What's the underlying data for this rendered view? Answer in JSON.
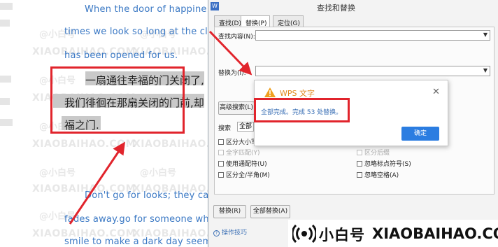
{
  "document": {
    "lines_en": [
      "When the door of happine",
      "times we look so long at the close",
      "has been opened for us.",
      "Don't go for looks; they can",
      "fades away.go for someone who",
      "smile to make a dark day seem b"
    ],
    "lines_cn": [
      "一扇通往幸福的门关闭了,",
      "我们徘徊在那扇关闭的门前,却",
      "福之门."
    ],
    "watermarks": [
      "@小白号",
      "XIAOBAIHAO.COM"
    ]
  },
  "dialog": {
    "title": "查找和替换",
    "logo": "W",
    "tabs": [
      "查找(D)",
      "替换(P)",
      "定位(G)"
    ],
    "find_label": "查找内容(N):",
    "replace_label": "替换为(I):",
    "advanced_button": "高级搜索(L)",
    "search_label": "搜索",
    "search_direction": "全部",
    "options_left": [
      "区分大小写",
      "全字匹配(Y)",
      "使用通配符(U)",
      "区分全/半角(M)"
    ],
    "options_right": [
      "区分后缀",
      "忽略标点符号(S)",
      "忽略空格(A)"
    ],
    "replace_button": "替换(R)",
    "replace_all_button": "全部替换(A)",
    "tips_link": "操作技巧"
  },
  "message": {
    "title": "WPS 文字",
    "text": "全部完成。完成 53 处替换。",
    "ok_button": "确定"
  },
  "brand": {
    "name": "小白号",
    "site": "XIAOBAIHAO.COM"
  },
  "colors": {
    "highlight_red": "#e1242c",
    "link_blue": "#3a78c4",
    "ok_blue": "#2b7de1"
  }
}
